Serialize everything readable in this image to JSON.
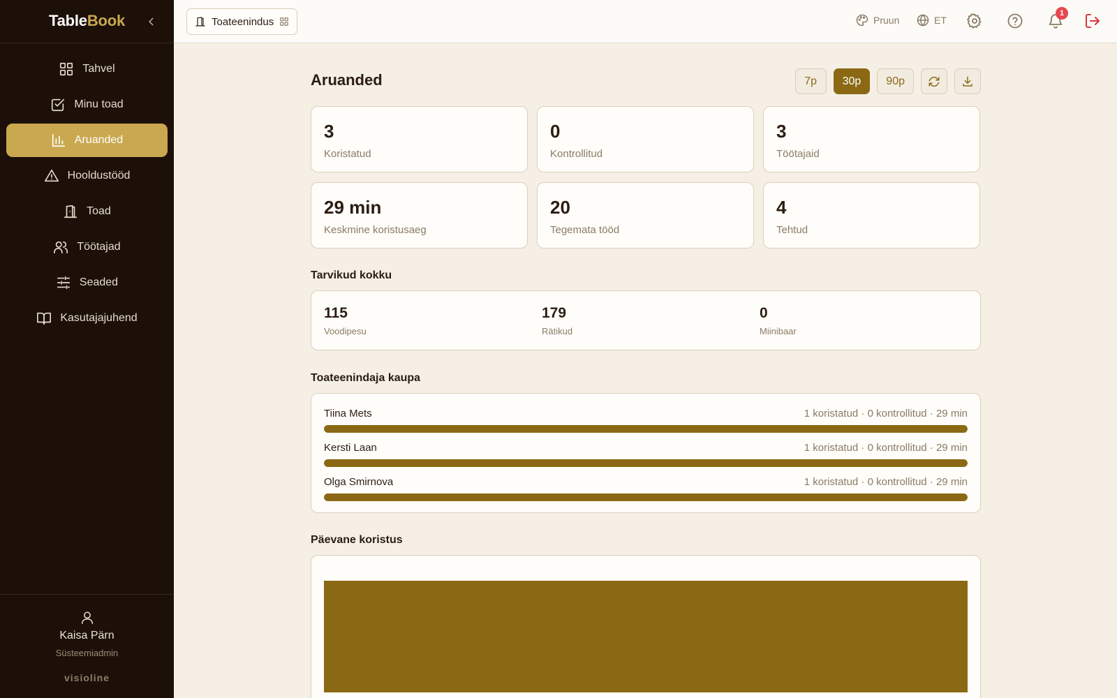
{
  "app": {
    "brand_part1": "Table",
    "brand_part2": "Book"
  },
  "sidebar": {
    "items": [
      {
        "label": "Tahvel",
        "icon": "grid-icon",
        "active": false
      },
      {
        "label": "Minu toad",
        "icon": "check-square-icon",
        "active": false
      },
      {
        "label": "Aruanded",
        "icon": "bar-chart-icon",
        "active": true
      },
      {
        "label": "Hooldustööd",
        "icon": "warning-icon",
        "active": false
      },
      {
        "label": "Toad",
        "icon": "door-icon",
        "active": false
      },
      {
        "label": "Töötajad",
        "icon": "users-icon",
        "active": false
      },
      {
        "label": "Seaded",
        "icon": "sliders-icon",
        "active": false
      },
      {
        "label": "Kasutajajuhend",
        "icon": "book-icon",
        "active": false
      }
    ],
    "user": {
      "name": "Kaisa Pärn",
      "role": "Süsteemiadmin"
    },
    "vendor": "visioline"
  },
  "topbar": {
    "department": "Toateenindus",
    "theme_label": "Pruun",
    "language_label": "ET",
    "notifications_count": "1"
  },
  "main": {
    "title": "Aruanded",
    "ranges": [
      {
        "label": "7p",
        "active": false
      },
      {
        "label": "30p",
        "active": true
      },
      {
        "label": "90p",
        "active": false
      }
    ],
    "stats": [
      {
        "value": "3",
        "label": "Koristatud"
      },
      {
        "value": "0",
        "label": "Kontrollitud"
      },
      {
        "value": "3",
        "label": "Töötajaid"
      },
      {
        "value": "29 min",
        "label": "Keskmine koristusaeg"
      },
      {
        "value": "20",
        "label": "Tegemata tööd"
      },
      {
        "value": "4",
        "label": "Tehtud"
      }
    ],
    "supplies_title": "Tarvikud kokku",
    "supplies": [
      {
        "value": "115",
        "label": "Voodipesu"
      },
      {
        "value": "179",
        "label": "Rätikud"
      },
      {
        "value": "0",
        "label": "Miinibaar"
      }
    ],
    "staff_title": "Toateenindaja kaupa",
    "staff": [
      {
        "name": "Tiina Mets",
        "stats": "1 koristatud · 0 kontrollitud · 29 min",
        "progress": 1.0
      },
      {
        "name": "Kersti Laan",
        "stats": "1 koristatud · 0 kontrollitud · 29 min",
        "progress": 1.0
      },
      {
        "name": "Olga Smirnova",
        "stats": "1 koristatud · 0 kontrollitud · 29 min",
        "progress": 1.0
      }
    ],
    "daily_title": "Päevane koristus"
  },
  "colors": {
    "accent": "#8b6914",
    "gold": "#c9a84f",
    "sidebar_bg": "#1c1008",
    "badge": "#e5484d"
  },
  "chart_data": {
    "type": "bar",
    "categories": [
      ""
    ],
    "values": [
      3
    ],
    "ylim": [
      0,
      3
    ],
    "title": "",
    "xlabel": "",
    "ylabel": ""
  }
}
